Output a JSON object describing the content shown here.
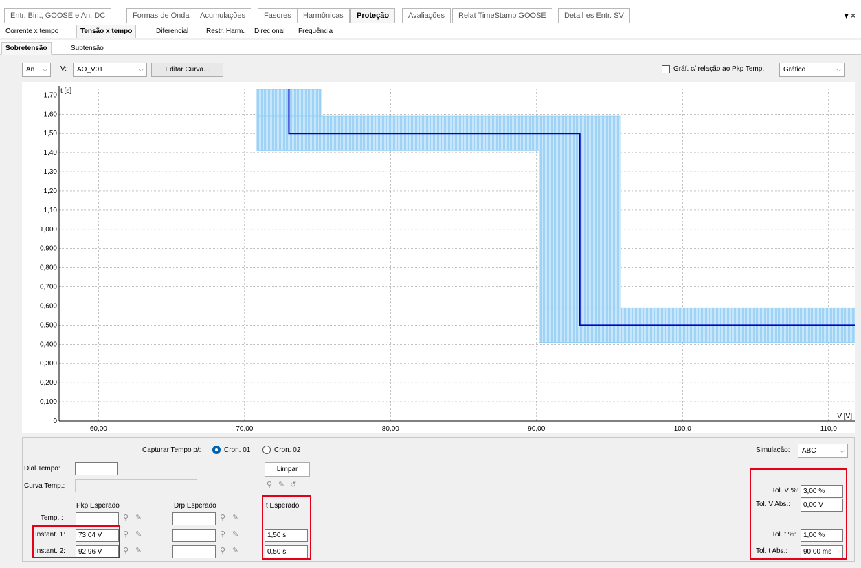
{
  "top_tabs": [
    {
      "label": "Entr. Bin., GOOSE e An. DC",
      "active": false
    },
    {
      "label": "Formas de Onda",
      "active": false
    },
    {
      "label": "Acumulações",
      "active": false
    },
    {
      "label": "Fasores",
      "active": false
    },
    {
      "label": "Harmônicas",
      "active": false
    },
    {
      "label": "Proteção",
      "active": true
    },
    {
      "label": "Avaliações",
      "active": false
    },
    {
      "label": "Relat TimeStamp GOOSE",
      "active": false
    },
    {
      "label": "Detalhes Entr. SV",
      "active": false
    }
  ],
  "window_controls": {
    "dropdown": "▾",
    "close": "×"
  },
  "sub_tabs": [
    {
      "label": "Corrente x tempo",
      "active": false
    },
    {
      "label": "Tensão x tempo",
      "active": true
    },
    {
      "label": "Diferencial",
      "active": false
    },
    {
      "label": "Restr. Harm.",
      "active": false
    },
    {
      "label": "Direcional",
      "active": false
    },
    {
      "label": "Frequência",
      "active": false
    }
  ],
  "mode_tabs": [
    {
      "label": "Sobretensão",
      "active": true
    },
    {
      "label": "Subtensão",
      "active": false
    }
  ],
  "toolbar": {
    "channel_type": "An",
    "v_label": "V:",
    "v_channel": "AO_V01",
    "edit_curve": "Editar Curva...",
    "pkp_relation_label": "Gráf. c/ relação ao Pkp Temp.",
    "pkp_relation_checked": false,
    "view_mode": "Gráfico"
  },
  "chart_data": {
    "type": "line",
    "title": "",
    "xlabel": "V [V]",
    "ylabel": "t [s]",
    "xlim": [
      57.3,
      111.8
    ],
    "ylim": [
      0,
      1.73
    ],
    "x_ticks": [
      60,
      70,
      80,
      90,
      100,
      110
    ],
    "x_tick_labels": [
      "60,00",
      "70,00",
      "80,00",
      "90,00",
      "100,0",
      "110,0"
    ],
    "y_ticks": [
      0,
      0.1,
      0.2,
      0.3,
      0.4,
      0.5,
      0.6,
      0.7,
      0.8,
      0.9,
      1.0,
      1.1,
      1.2,
      1.3,
      1.4,
      1.5,
      1.6,
      1.7
    ],
    "y_tick_labels": [
      "0",
      "0,100",
      "0,200",
      "0,300",
      "0,400",
      "0,500",
      "0,600",
      "0,700",
      "0,800",
      "0,900",
      "1,000",
      "1,10",
      "1,20",
      "1,30",
      "1,40",
      "1,50",
      "1,60",
      "1,70"
    ],
    "grid": true,
    "series": [
      {
        "color": "#0000cc",
        "points": [
          [
            73.04,
            1.73
          ],
          [
            73.04,
            1.5
          ],
          [
            92.96,
            1.5
          ],
          [
            92.96,
            0.5
          ],
          [
            111.8,
            0.5
          ]
        ]
      }
    ],
    "tolerance_band_color": "#9fd3f5",
    "tolerance_bands": [
      {
        "x": [
          70.85,
          75.23
        ],
        "y": [
          1.41,
          1.73
        ]
      },
      {
        "x": [
          70.85,
          90.17
        ],
        "y": [
          1.41,
          1.59
        ]
      },
      {
        "x": [
          90.17,
          95.75
        ],
        "y": [
          0.41,
          1.59
        ]
      },
      {
        "x": [
          90.17,
          111.8
        ],
        "y": [
          0.41,
          0.59
        ]
      }
    ]
  },
  "bottom": {
    "capture_label": "Capturar Tempo p/:",
    "cron1": "Cron. 01",
    "cron2": "Cron. 02",
    "cron_selected": "Cron. 01",
    "clear_button": "Limpar",
    "dial_label": "Dial Tempo:",
    "dial_value": "",
    "curve_label": "Curva Temp.:",
    "curve_value": "",
    "pkp_header": "Pkp Esperado",
    "drp_header": "Drp Esperado",
    "t_header": "t Esperado",
    "rows": [
      {
        "label": "Temp. :",
        "pkp": "",
        "drp": "",
        "t": ""
      },
      {
        "label": "Instant. 1:",
        "pkp": "73,04 V",
        "drp": "",
        "t": "1,50 s"
      },
      {
        "label": "Instant. 2:",
        "pkp": "92,96 V",
        "drp": "",
        "t": "0,50 s"
      }
    ],
    "simulation_label": "Simulação:",
    "simulation_value": "ABC",
    "tol_v_pct_label": "Tol. V %:",
    "tol_v_pct": "3,00 %",
    "tol_v_abs_label": "Tol. V Abs.:",
    "tol_v_abs": "0,00 V",
    "tol_t_pct_label": "Tol. t %:",
    "tol_t_pct": "1,00 %",
    "tol_t_abs_label": "Tol. t Abs.:",
    "tol_t_abs": "90,00 ms"
  },
  "colors": {
    "highlight_box": "#e3001b",
    "curve": "#0000cc",
    "band": "#9fd3f5",
    "radio_selected": "#0063b1"
  }
}
